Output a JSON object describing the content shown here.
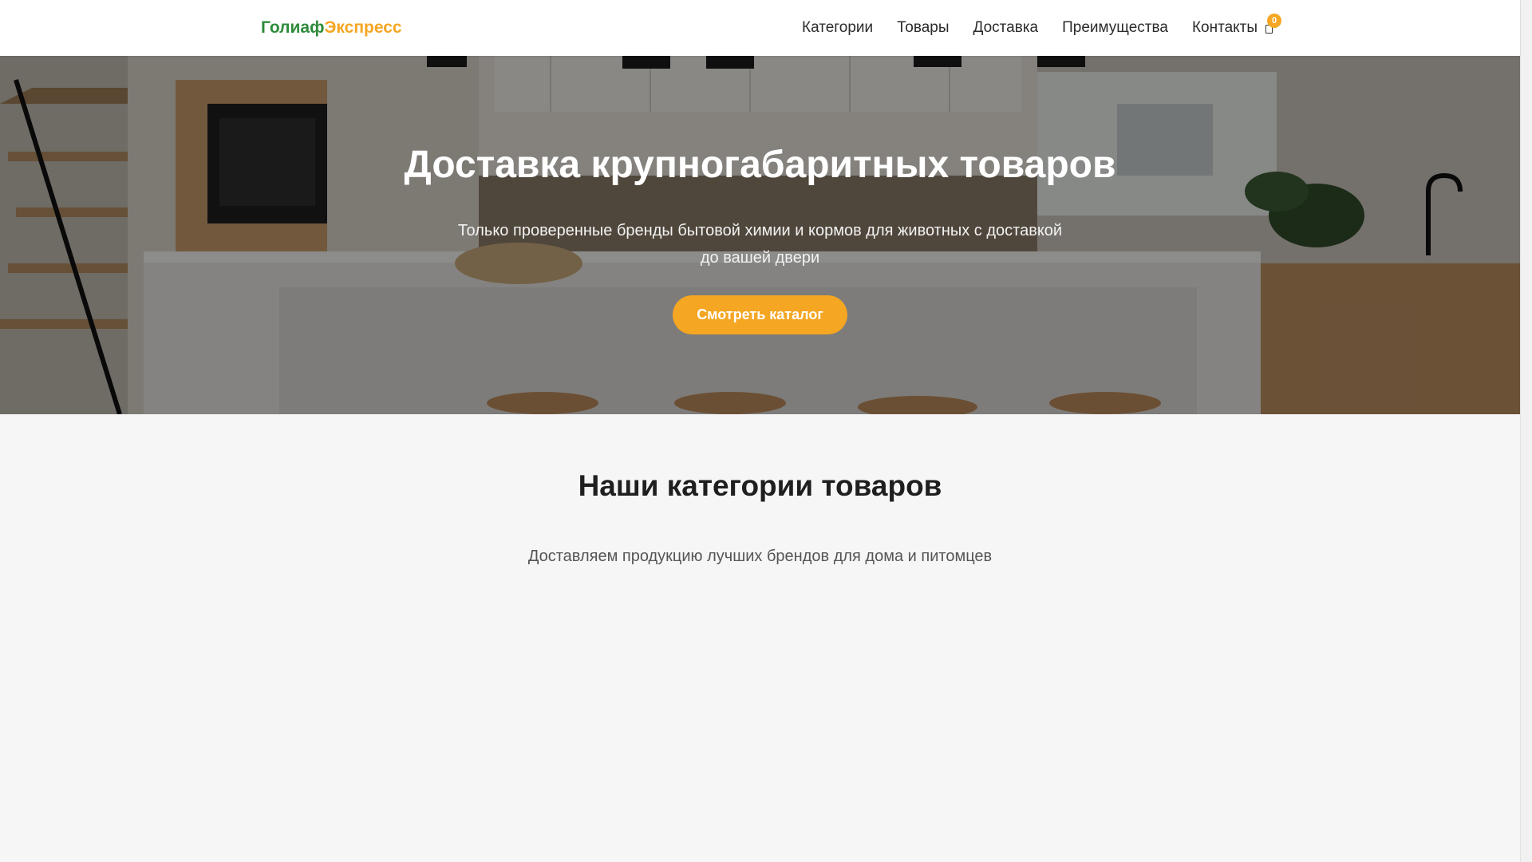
{
  "header": {
    "logo_part1": "Голиаф",
    "logo_part2": "Экспресс",
    "nav": [
      "Категории",
      "Товары",
      "Доставка",
      "Преимущества",
      "Контакты"
    ],
    "cart_count": "0",
    "cart_icon": "shopping-cart-icon"
  },
  "hero": {
    "title": "Доставка крупногабаритных товаров",
    "subtitle": "Только проверенные бренды бытовой химии и кормов для животных с доставкой до вашей двери",
    "cta_label": "Смотреть каталог"
  },
  "categories": {
    "title": "Наши категории товаров",
    "subtitle": "Доставляем продукцию лучших брендов для дома и питомцев"
  },
  "colors": {
    "brand_green": "#2e8b3a",
    "brand_orange": "#f5a623",
    "page_background": "#f6f6f6"
  }
}
